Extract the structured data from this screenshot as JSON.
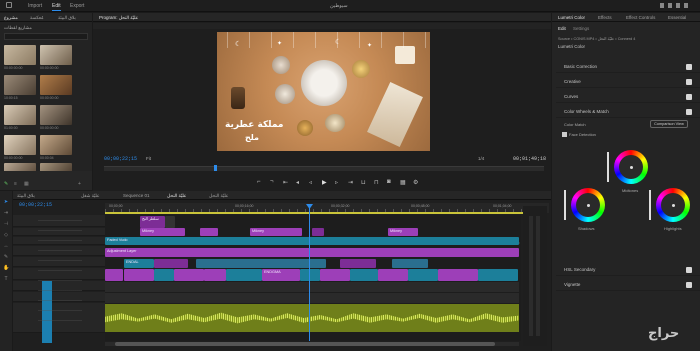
{
  "topbar": {
    "menus": [
      "Import",
      "Edit",
      "Export"
    ],
    "active_menu": "Edit",
    "title": "سيوطين"
  },
  "project": {
    "tabs": [
      "مشروع",
      "مُعكسة",
      "بلاق البيئة"
    ],
    "bin_label": "مشاريع لقطات",
    "thumbs": [
      "00:00:00:00",
      "00:00:00:00",
      "10:00:15",
      "00:00:00:00",
      "01:00:00",
      "00:00:00:00",
      "00:00:00:00",
      "00:00:04",
      "00:00:00:00",
      "00:00:00:00"
    ]
  },
  "source": {
    "tab": "بلاق البيئة"
  },
  "program": {
    "tab": "Program: عليّة النحل",
    "timecode": "00;00;22;15",
    "fit": "Fit",
    "quality": "1/4",
    "duration": "00;01;49;18",
    "overlay_line1": "مملكة عطرية",
    "overlay_line2": "ملح"
  },
  "lumetri": {
    "tabs": [
      "Lumetri Color",
      "Effects",
      "Effect Controls",
      "Essential"
    ],
    "subtabs": [
      "Edit",
      "Settings"
    ],
    "source_line": "Source • CONIS MP4 • عليّة النحل • Connerd 4",
    "fx_label": "Lumetri Color",
    "sections": [
      "Basic Correction",
      "Creative",
      "Curves",
      "Color Wheels & Match",
      "HSL Secondary",
      "Vignette"
    ],
    "color_match": "Color Match",
    "comparison_btn": "Comparison View",
    "face_detection": "Face Detection",
    "wheel_labels": [
      "Midtones",
      "Shadows",
      "Highlights"
    ]
  },
  "timeline": {
    "tabs": [
      "عليّة النحل",
      "Sequence 01",
      "عليّة النحل",
      "عليّة شغل",
      "بلاق البيئة"
    ],
    "timecode": "00;00;22;15",
    "ruler": [
      "00;00;00",
      "00;00;16;00",
      "00;00;32;00",
      "00;00;48;00",
      "00;01;04;00"
    ],
    "clips": [
      {
        "label": "سلطر النح",
        "color": "purple"
      },
      {
        "label": "Mikney",
        "color": "purple"
      },
      {
        "label": "Mikney",
        "color": "purple"
      },
      {
        "label": "Mikney",
        "color": "purple"
      },
      {
        "label": "Faded Vudo",
        "color": "teal"
      },
      {
        "label": "Adjustment Layer",
        "color": "purple"
      },
      {
        "label": "ENDAL",
        "color": "teal"
      },
      {
        "label": "ENDGMA",
        "color": "teal"
      }
    ]
  },
  "watermark": "حراج"
}
